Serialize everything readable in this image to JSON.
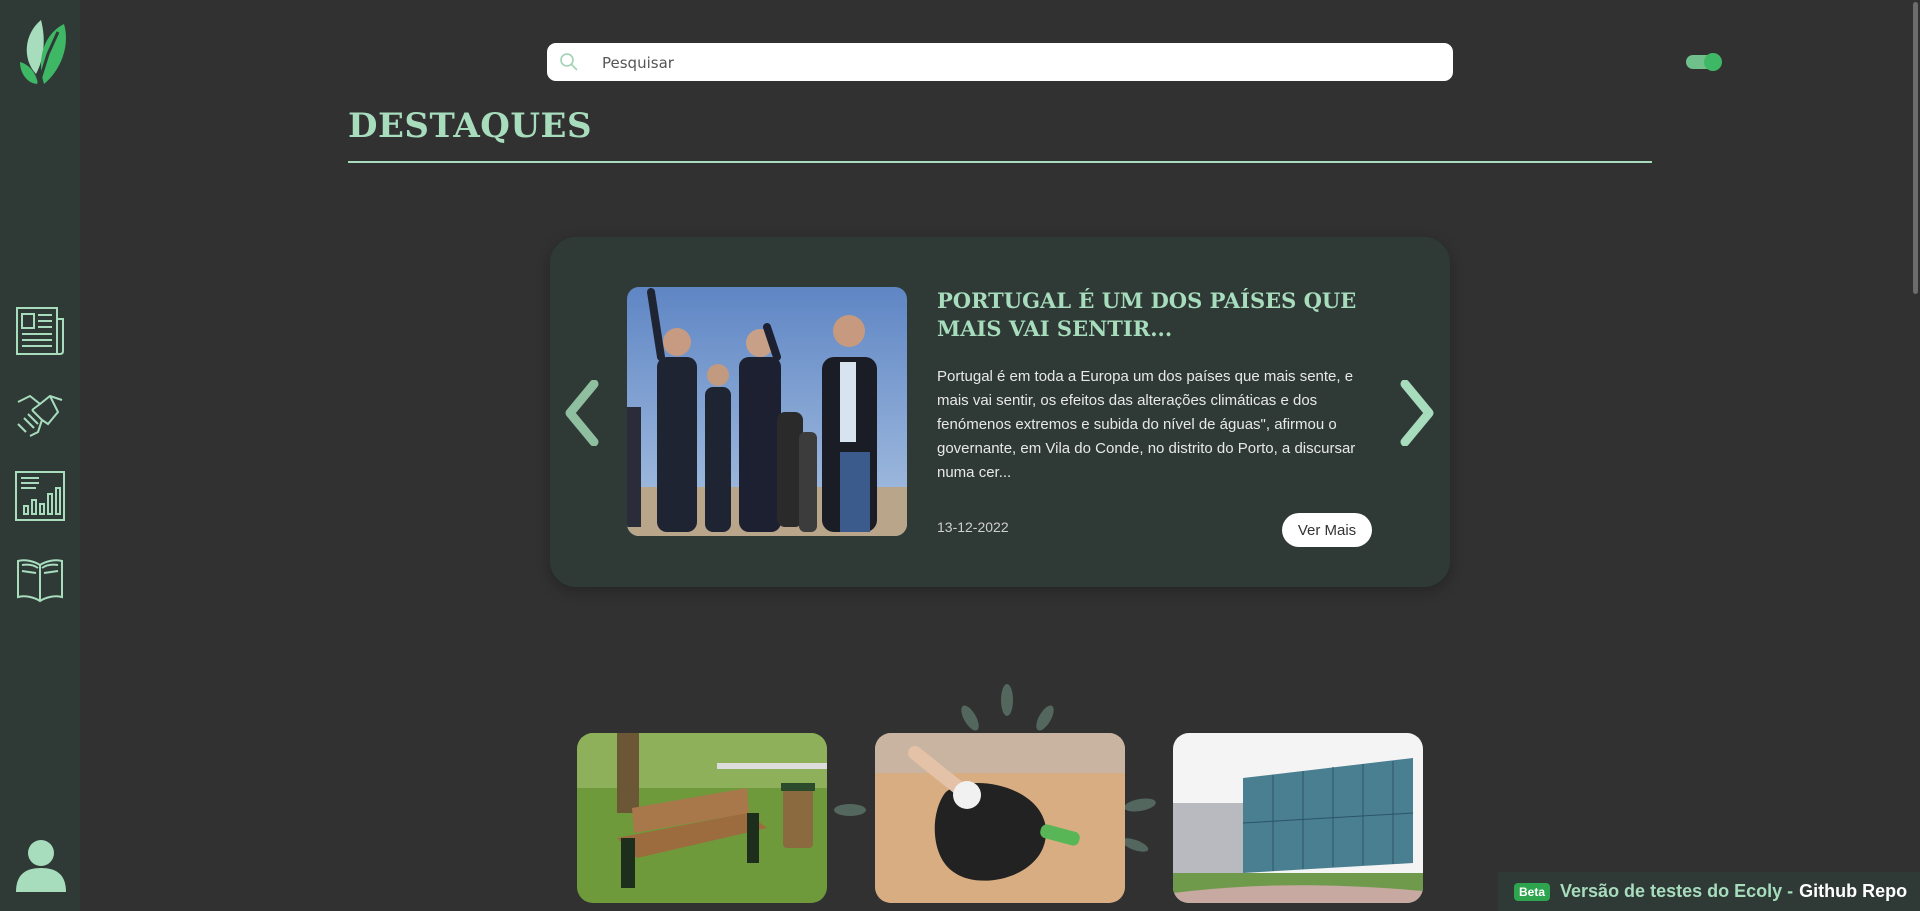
{
  "colors": {
    "background": "#313131",
    "sidebar": "#2f3a37",
    "accent_mint": "#a7dcbd",
    "accent_green": "#3fb866",
    "card_bg": "#2f3a37",
    "beta_badge": "#2ea44f"
  },
  "sidebar": {
    "logo_icon": "ecoly-leaf-logo",
    "items": [
      {
        "icon": "newspaper-icon"
      },
      {
        "icon": "helping-hands-icon"
      },
      {
        "icon": "bar-chart-icon"
      },
      {
        "icon": "open-book-icon"
      }
    ],
    "profile_icon": "user-avatar-icon"
  },
  "search": {
    "placeholder": "Pesquisar",
    "value": "",
    "icon": "search-icon"
  },
  "theme_toggle": {
    "state": "on",
    "icon": "toggle-switch"
  },
  "page": {
    "title": "DESTAQUES"
  },
  "carousel": {
    "prev_icon": "chevron-left-icon",
    "next_icon": "chevron-right-icon",
    "item": {
      "title": "PORTUGAL É UM DOS PAÍSES QUE MAIS VAI SENTIR...",
      "excerpt": "Portugal é em toda a Europa um dos países que mais sente, e mais vai sentir, os efeitos das alterações climáticas e dos fenómenos extremos e subida do nível de águas\", afirmou o governante, em Vila do Conde, no distrito do Porto, a discursar numa cer...",
      "date": "13-12-2022",
      "button_label": "Ver Mais"
    }
  },
  "cards": [
    {
      "image": "park-bench-photo"
    },
    {
      "image": "beach-cleanup-photo"
    },
    {
      "image": "glass-building-photo"
    }
  ],
  "beta_bar": {
    "badge": "Beta",
    "text": "Versão de testes do Ecoly -",
    "link_label": "Github Repo"
  }
}
